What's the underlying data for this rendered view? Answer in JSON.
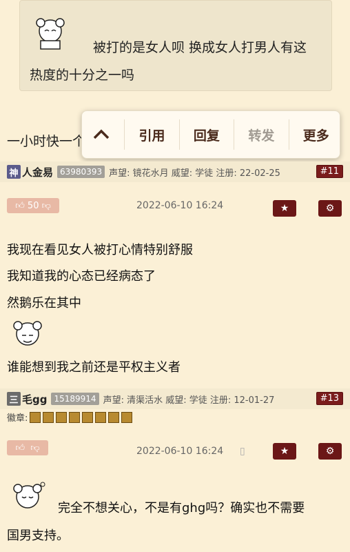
{
  "quote": {
    "text_line1": "被打的是女人呗 换成女人打男人有这",
    "text_line2": "热度的十分之一吗"
  },
  "reply_snippet": "一小时快一个",
  "popup": {
    "up_label": "^",
    "quote_label": "引用",
    "reply_label": "回复",
    "forward_label": "转发",
    "more_label": "更多"
  },
  "post1": {
    "badge": "神",
    "username": "人金易",
    "uid": "63980393",
    "info": "声望: 镜花水月  威望: 学徒  注册: 22-02-25",
    "floor": "#11",
    "likes": "50",
    "datetime": "2022-06-10 16:24",
    "device": "",
    "lines": [
      "我现在看见女人被打心情特别舒服",
      "我知道我的心态已经病态了",
      "然鹅乐在其中",
      "谁能想到我之前还是平权主义者"
    ]
  },
  "post2": {
    "badge": "三",
    "username": "毛gg",
    "uid": "15189914",
    "info": "声望: 清渠活水  威望: 学徒  注册: 12-01-27",
    "floor": "#13",
    "medals_label": "徽章:",
    "medals_count": 8,
    "datetime": "2022-06-10 16:24",
    "lines": [
      "完全不想关心，不是有ghg吗？确实也不需要",
      "国男支持。"
    ]
  },
  "colors": {
    "accent": "#6b1717",
    "background": "#fbf0d6"
  }
}
